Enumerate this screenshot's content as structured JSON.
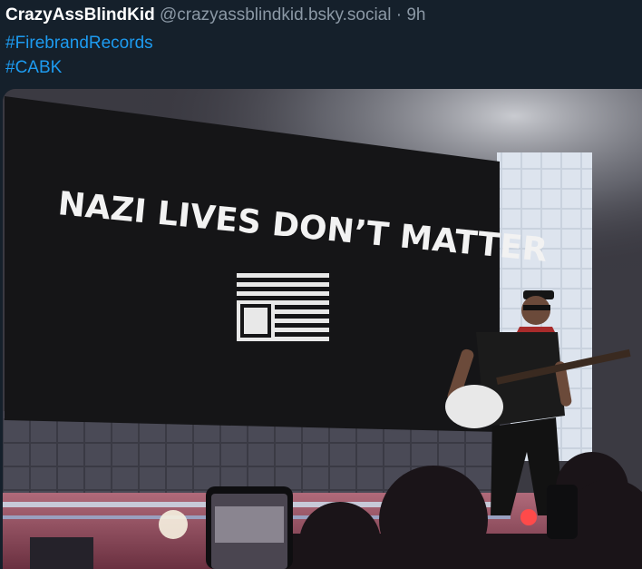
{
  "post": {
    "display_name": "CrazyAssBlindKid",
    "handle": "@crazyassblindkid.bsky.social",
    "separator": "·",
    "time": "9h",
    "hashtags": [
      "#FirebrandRecords",
      "#CABK"
    ]
  },
  "media": {
    "screen_text": "NAZI LIVES DON’T MATTER",
    "alt": "concert-photo-guitarist"
  },
  "colors": {
    "background": "#15202b",
    "link": "#1d9bf0",
    "handle": "#8b98a5"
  }
}
